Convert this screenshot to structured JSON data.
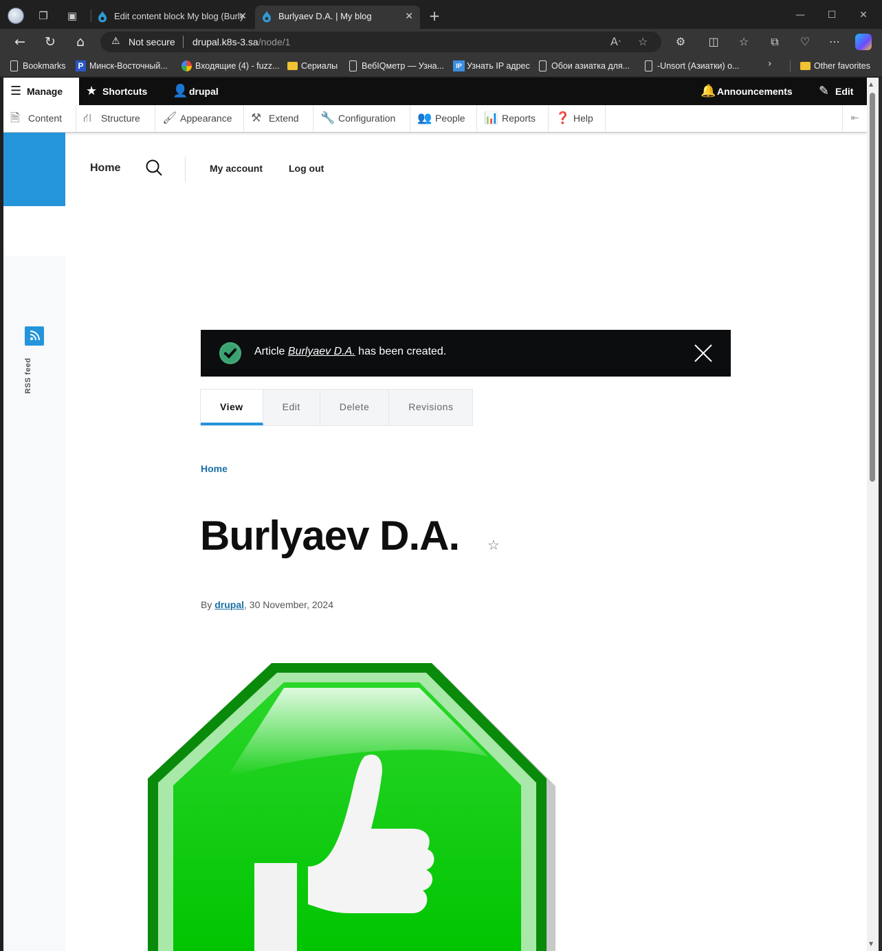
{
  "browser": {
    "tabs": [
      {
        "title": "Edit content block My blog (Burly",
        "active": false
      },
      {
        "title": "Burlyaev D.A. | My blog",
        "active": true
      }
    ],
    "address": {
      "security": "Not secure",
      "host": "drupal.k8s-3.sa",
      "path": "/node/1"
    },
    "bookmarks": [
      {
        "label": "Bookmarks",
        "icon": "file-icon"
      },
      {
        "label": "Минск-Восточный...",
        "icon": "p-icon"
      },
      {
        "label": "Входящие (4) - fuzz...",
        "icon": "google-icon"
      },
      {
        "label": "Сериалы",
        "icon": "folder-icon"
      },
      {
        "label": "ВебIQметр — Узна...",
        "icon": "file-icon"
      },
      {
        "label": "Узнать IP адрес",
        "icon": "ip-icon"
      },
      {
        "label": "Обои азиатка для...",
        "icon": "file-icon"
      },
      {
        "label": "-Unsort (Азиатки) о...",
        "icon": "file-icon"
      }
    ],
    "other_favorites": "Other favorites"
  },
  "admin_toolbar": {
    "manage": "Manage",
    "shortcuts": "Shortcuts",
    "user": "drupal",
    "announcements": "Announcements",
    "edit": "Edit",
    "tray": [
      "Content",
      "Structure",
      "Appearance",
      "Extend",
      "Configuration",
      "People",
      "Reports",
      "Help"
    ]
  },
  "site_nav": {
    "home": "Home",
    "my_account": "My account",
    "log_out": "Log out"
  },
  "rss": {
    "label": "RSS feed"
  },
  "message": {
    "prefix": "Article",
    "link": "Burlyaev D.A.",
    "suffix": "has been created."
  },
  "local_tabs": [
    "View",
    "Edit",
    "Delete",
    "Revisions"
  ],
  "breadcrumb": "Home",
  "article": {
    "title": "Burlyaev D.A.",
    "by": "By",
    "author": "drupal",
    "date": ", 30 November, 2024"
  }
}
